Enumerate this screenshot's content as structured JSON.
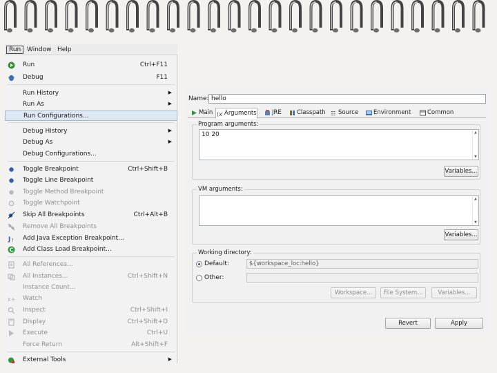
{
  "menubar": {
    "items": [
      {
        "label": "Run",
        "open": true
      },
      {
        "label": "Window"
      },
      {
        "label": "Help"
      }
    ]
  },
  "run_menu": {
    "items": [
      {
        "label": "Run",
        "accel": "Ctrl+F11",
        "icon": "run-icon"
      },
      {
        "label": "Debug",
        "accel": "F11",
        "icon": "debug-icon"
      },
      {
        "label": "Run History",
        "submenu": true
      },
      {
        "label": "Run As",
        "submenu": true
      },
      {
        "label": "Run Configurations...",
        "selected": true
      },
      {
        "label": "Debug History",
        "submenu": true
      },
      {
        "label": "Debug As",
        "submenu": true
      },
      {
        "label": "Debug Configurations..."
      },
      {
        "label": "Toggle Breakpoint",
        "accel": "Ctrl+Shift+B",
        "icon": "breakpoint-icon"
      },
      {
        "label": "Toggle Line Breakpoint",
        "icon": "line-breakpoint-icon"
      },
      {
        "label": "Toggle Method Breakpoint",
        "disabled": true,
        "icon": "method-breakpoint-icon"
      },
      {
        "label": "Toggle Watchpoint",
        "disabled": true,
        "icon": "watchpoint-icon"
      },
      {
        "label": "Skip All Breakpoints",
        "accel": "Ctrl+Alt+B",
        "icon": "skip-breakpoints-icon"
      },
      {
        "label": "Remove All Breakpoints",
        "disabled": true,
        "icon": "remove-breakpoints-icon"
      },
      {
        "label": "Add Java Exception Breakpoint...",
        "icon": "exception-breakpoint-icon"
      },
      {
        "label": "Add Class Load Breakpoint...",
        "icon": "class-load-breakpoint-icon"
      },
      {
        "label": "All References...",
        "disabled": true,
        "icon": "references-icon"
      },
      {
        "label": "All Instances...",
        "accel": "Ctrl+Shift+N",
        "disabled": true,
        "icon": "instances-icon"
      },
      {
        "label": "Instance Count...",
        "disabled": true
      },
      {
        "label": "Watch",
        "disabled": true,
        "icon": "watch-icon"
      },
      {
        "label": "Inspect",
        "accel": "Ctrl+Shift+I",
        "disabled": true,
        "icon": "inspect-icon"
      },
      {
        "label": "Display",
        "accel": "Ctrl+Shift+D",
        "disabled": true,
        "icon": "display-icon"
      },
      {
        "label": "Execute",
        "accel": "Ctrl+U",
        "disabled": true,
        "icon": "execute-icon"
      },
      {
        "label": "Force Return",
        "accel": "Alt+Shift+F",
        "disabled": true
      },
      {
        "label": "External Tools",
        "submenu": true,
        "icon": "external-tools-icon"
      }
    ]
  },
  "dialog": {
    "name_label": "Name:",
    "name_value": "hello",
    "tabs": [
      {
        "label": "Main",
        "icon": "main-tab-icon"
      },
      {
        "label": "Arguments",
        "icon": "arguments-tab-icon",
        "active": true
      },
      {
        "label": "JRE",
        "icon": "jre-tab-icon"
      },
      {
        "label": "Classpath",
        "icon": "classpath-tab-icon"
      },
      {
        "label": "Source",
        "icon": "source-tab-icon"
      },
      {
        "label": "Environment",
        "icon": "environment-tab-icon"
      },
      {
        "label": "Common",
        "icon": "common-tab-icon"
      }
    ],
    "program_args": {
      "title": "Program arguments:",
      "value": "10 20",
      "variables_label": "Variables..."
    },
    "vm_args": {
      "title": "VM arguments:",
      "value": "",
      "variables_label": "Variables..."
    },
    "working_dir": {
      "title": "Working directory:",
      "default_label": "Default:",
      "default_value": "${workspace_loc:hello}",
      "other_label": "Other:",
      "other_value": "",
      "selected": "default",
      "buttons": [
        "Workspace...",
        "File System...",
        "Variables..."
      ]
    },
    "revert_label": "Revert",
    "apply_label": "Apply"
  }
}
